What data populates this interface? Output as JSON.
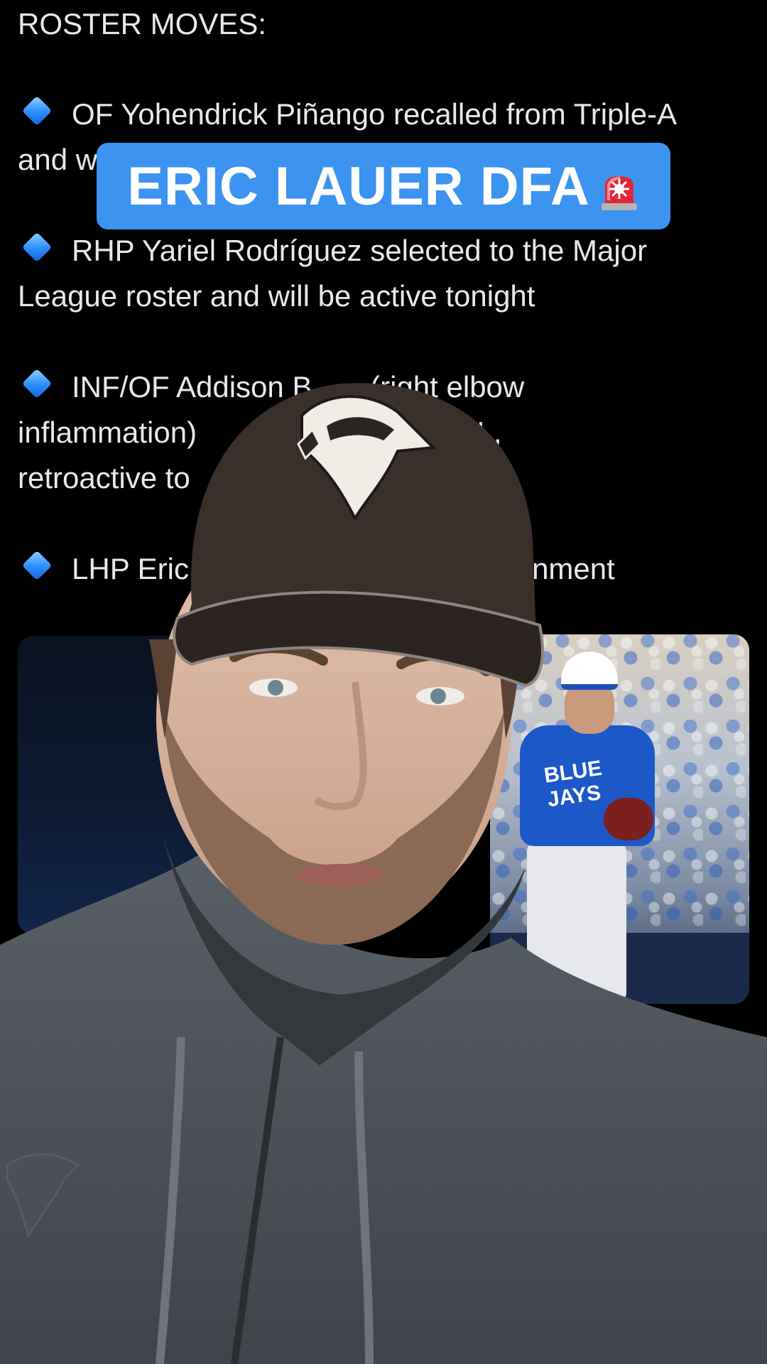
{
  "tweet": {
    "heading": "ROSTER MOVES:",
    "moves": [
      {
        "line1": "OF Yohendrick Piñango recalled from Triple-A",
        "line2": "and w"
      },
      {
        "line1": "RHP Yariel Rodríguez selected to the Major",
        "line2": "League roster and will be active tonight"
      },
      {
        "line1": "INF/OF Addison B       (right elbow",
        "line2": "inflammation)                          day IL,",
        "line3": "retroactive to"
      },
      {
        "line1": "LHP Eric                                 assignment"
      }
    ]
  },
  "caption": {
    "text": "ERIC LAUER DFA",
    "emoji": "siren-icon"
  },
  "photo": {
    "jersey_text": "BLUE JAYS"
  },
  "colors": {
    "caption_bg": "#3c93f0",
    "background": "#000000",
    "hoodie": "#4b5157",
    "cap": "#3a302b"
  }
}
